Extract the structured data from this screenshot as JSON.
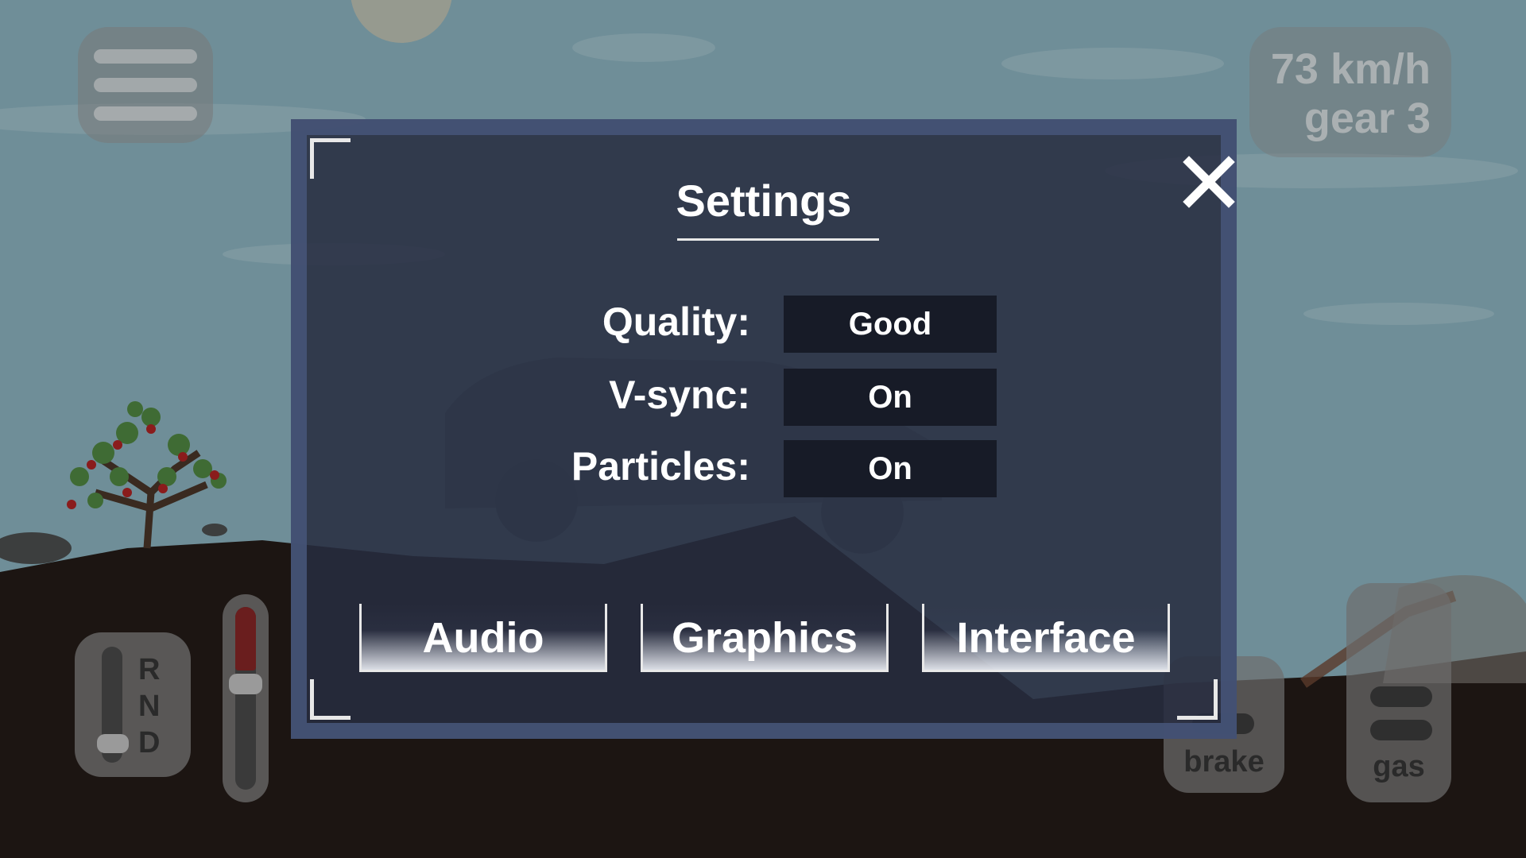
{
  "hud": {
    "speed_text": "73 km/h",
    "gear_text": "gear 3",
    "gear_letters": [
      "R",
      "N",
      "D"
    ],
    "brake_label": "brake",
    "gas_label": "gas"
  },
  "settings": {
    "title": "Settings",
    "rows": [
      {
        "label": "Quality:",
        "value": "Good"
      },
      {
        "label": "V-sync:",
        "value": "On"
      },
      {
        "label": "Particles:",
        "value": "On"
      }
    ],
    "tabs": [
      "Audio",
      "Graphics",
      "Interface"
    ]
  },
  "colors": {
    "sky": "#6f8e98",
    "ground": "#1c1512",
    "dialog_bg": "#262c40",
    "dialog_border": "#46547a",
    "value_box": "#171b27",
    "text": "#ffffff"
  },
  "icons": [
    "menu-icon",
    "close-icon",
    "tree-icon",
    "car-silhouette",
    "sun-icon"
  ]
}
